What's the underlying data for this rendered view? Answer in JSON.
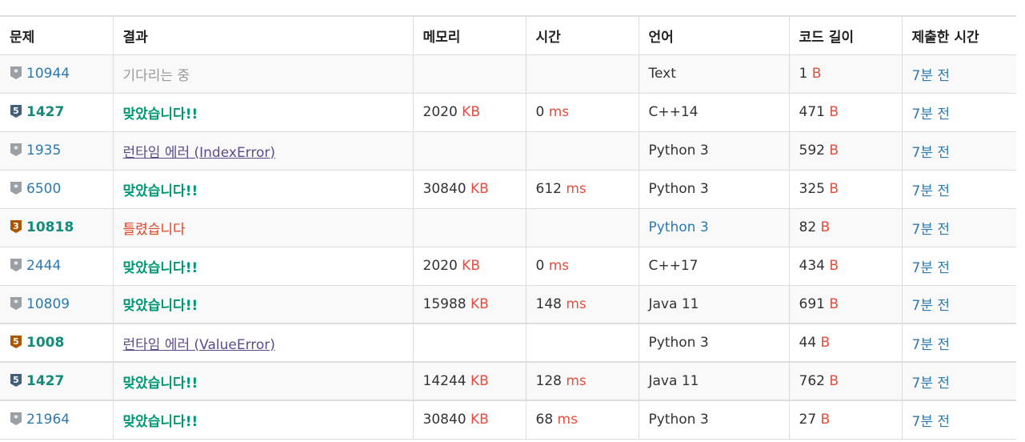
{
  "headers": [
    "문제",
    "결과",
    "메모리",
    "시간",
    "언어",
    "코드 길이",
    "제출한 시간"
  ],
  "units": {
    "memory": "KB",
    "time": "ms",
    "code": "B"
  },
  "tier_colors": {
    "unrated": "#9aa0a6",
    "silver": "#435f7a",
    "bronze": "#ad5600"
  },
  "rows": [
    {
      "tier": "unrated",
      "tier_label": "*",
      "problem": "10944",
      "bold": false,
      "result": "기다리는 중",
      "result_type": "wait",
      "memory": "",
      "time": "",
      "lang": "Text",
      "lang_link": false,
      "code": "1",
      "submitted": "7분 전",
      "strong_top": false
    },
    {
      "tier": "silver",
      "tier_label": "5",
      "problem": "1427",
      "bold": true,
      "result": "맞았습니다!!",
      "result_type": "ac",
      "memory": "2020",
      "time": "0",
      "lang": "C++14",
      "lang_link": false,
      "code": "471",
      "submitted": "7분 전",
      "strong_top": false
    },
    {
      "tier": "unrated",
      "tier_label": "*",
      "problem": "1935",
      "bold": false,
      "result": "런타임 에러 (IndexError)",
      "result_type": "rte",
      "memory": "",
      "time": "",
      "lang": "Python 3",
      "lang_link": false,
      "code": "592",
      "submitted": "7분 전",
      "strong_top": false
    },
    {
      "tier": "unrated",
      "tier_label": "*",
      "problem": "6500",
      "bold": false,
      "result": "맞았습니다!!",
      "result_type": "ac",
      "memory": "30840",
      "time": "612",
      "lang": "Python 3",
      "lang_link": false,
      "code": "325",
      "submitted": "7분 전",
      "strong_top": false
    },
    {
      "tier": "bronze",
      "tier_label": "3",
      "problem": "10818",
      "bold": true,
      "result": "틀렸습니다",
      "result_type": "wa",
      "memory": "",
      "time": "",
      "lang": "Python 3",
      "lang_link": true,
      "code": "82",
      "submitted": "7분 전",
      "strong_top": false
    },
    {
      "tier": "unrated",
      "tier_label": "*",
      "problem": "2444",
      "bold": false,
      "result": "맞았습니다!!",
      "result_type": "ac",
      "memory": "2020",
      "time": "0",
      "lang": "C++17",
      "lang_link": false,
      "code": "434",
      "submitted": "7분 전",
      "strong_top": false
    },
    {
      "tier": "unrated",
      "tier_label": "*",
      "problem": "10809",
      "bold": false,
      "result": "맞았습니다!!",
      "result_type": "ac",
      "memory": "15988",
      "time": "148",
      "lang": "Java 11",
      "lang_link": false,
      "code": "691",
      "submitted": "7분 전",
      "strong_top": false
    },
    {
      "tier": "bronze",
      "tier_label": "5",
      "problem": "1008",
      "bold": true,
      "result": "런타임 에러 (ValueError)",
      "result_type": "rte",
      "memory": "",
      "time": "",
      "lang": "Python 3",
      "lang_link": false,
      "code": "44",
      "submitted": "7분 전",
      "strong_top": true
    },
    {
      "tier": "silver",
      "tier_label": "5",
      "problem": "1427",
      "bold": true,
      "result": "맞았습니다!!",
      "result_type": "ac",
      "memory": "14244",
      "time": "128",
      "lang": "Java 11",
      "lang_link": false,
      "code": "762",
      "submitted": "7분 전",
      "strong_top": true
    },
    {
      "tier": "unrated",
      "tier_label": "*",
      "problem": "21964",
      "bold": false,
      "result": "맞았습니다!!",
      "result_type": "ac",
      "memory": "30840",
      "time": "68",
      "lang": "Python 3",
      "lang_link": false,
      "code": "27",
      "submitted": "7분 전",
      "strong_top": true
    }
  ]
}
